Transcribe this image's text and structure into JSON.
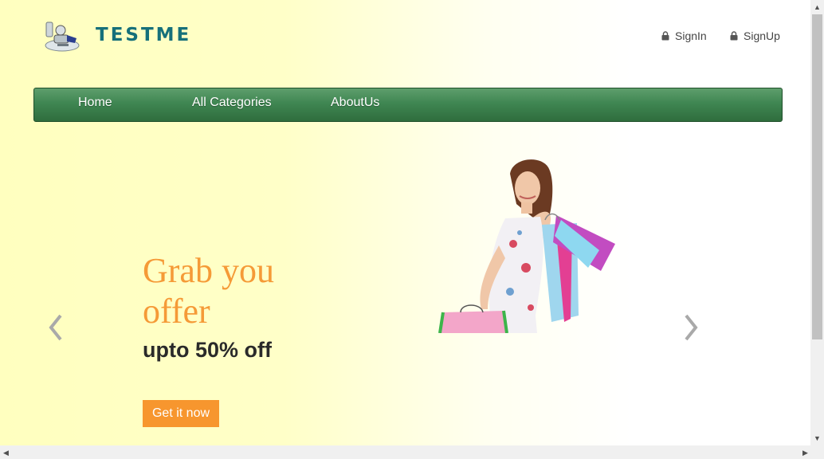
{
  "header": {
    "brand": "TESTME",
    "signin_label": "SignIn",
    "signup_label": "SignUp",
    "icons": {
      "logo": "logo-mascot-icon",
      "auth": "lock-icon"
    }
  },
  "nav": {
    "items": [
      {
        "label": "Home"
      },
      {
        "label": "All Categories"
      },
      {
        "label": "AboutUs"
      }
    ]
  },
  "hero": {
    "headline": "Grab you offer",
    "subheadline": "upto 50% off",
    "cta_label": "Get it now",
    "prev_icon": "chevron-left-icon",
    "next_icon": "chevron-right-icon"
  },
  "colors": {
    "brand": "#16707a",
    "nav_green": "#3f8652",
    "headline_orange": "#f59a37",
    "cta_orange": "#f7962e"
  }
}
